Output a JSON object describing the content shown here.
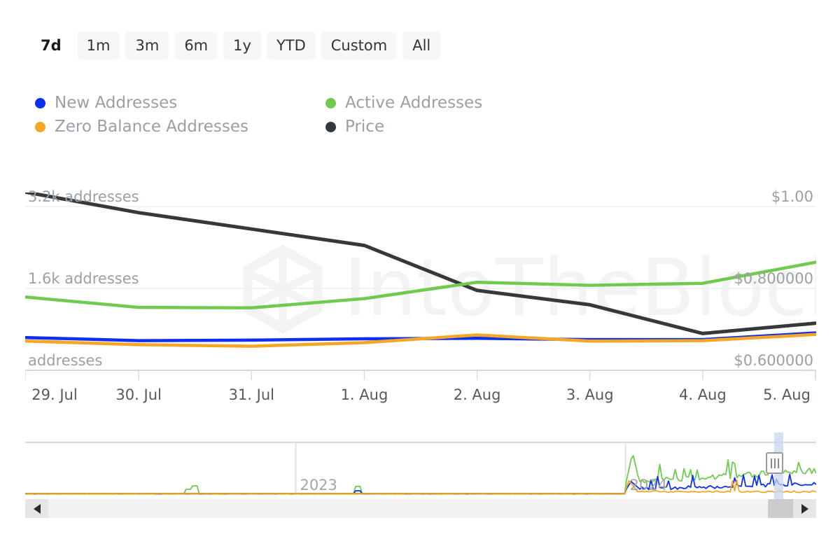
{
  "range_selector": {
    "buttons": [
      {
        "label": "7d",
        "active": true
      },
      {
        "label": "1m",
        "active": false
      },
      {
        "label": "3m",
        "active": false
      },
      {
        "label": "6m",
        "active": false
      },
      {
        "label": "1y",
        "active": false
      },
      {
        "label": "YTD",
        "active": false
      },
      {
        "label": "Custom",
        "active": false
      },
      {
        "label": "All",
        "active": false
      }
    ]
  },
  "legend": {
    "items": [
      {
        "label": "New Addresses",
        "color": "#0d2ff0"
      },
      {
        "label": "Active Addresses",
        "color": "#6ecb4d"
      },
      {
        "label": "Zero Balance Addresses",
        "color": "#f5a623"
      },
      {
        "label": "Price",
        "color": "#36393c"
      }
    ]
  },
  "watermark": {
    "text": "IntoTheBlock"
  },
  "navigator": {
    "year_labels": [
      {
        "text": "2023",
        "x_pct": 34.2
      },
      {
        "text": "2024",
        "x_pct": 75.9
      }
    ],
    "selection": {
      "start_pct": 94.7,
      "end_pct": 95.8
    },
    "scroll_left_icon": "triangle-left-icon",
    "scroll_right_icon": "triangle-right-icon",
    "handle_icon": "grip-vertical-icon"
  },
  "chart_data": {
    "type": "line",
    "title": "",
    "xlabel": "",
    "ylabel": "addresses",
    "grid": true,
    "legend_position": "top-left",
    "x": [
      "29. Jul",
      "30. Jul",
      "31. Jul",
      "1. Aug",
      "2. Aug",
      "3. Aug",
      "4. Aug",
      "5. Aug"
    ],
    "left_axis": {
      "label_suffix": "addresses",
      "ticks": [
        "addresses",
        "1.6k addresses",
        "3.2k addresses"
      ],
      "tick_values": [
        0,
        1600,
        3200
      ],
      "ylim": [
        0,
        4000
      ]
    },
    "right_axis": {
      "ticks": [
        "$0.600000",
        "$0.800000",
        "$1.00"
      ],
      "tick_values": [
        0.6,
        0.8,
        1.0
      ],
      "ylim": [
        0.52,
        1.06
      ]
    },
    "series": [
      {
        "name": "Active Addresses",
        "color": "#6ecb4d",
        "axis": "left",
        "values": [
          1430,
          1230,
          1220,
          1400,
          1720,
          1660,
          1700,
          2110
        ]
      },
      {
        "name": "New Addresses",
        "color": "#0d2ff0",
        "axis": "left",
        "values": [
          640,
          580,
          590,
          615,
          625,
          600,
          600,
          730
        ]
      },
      {
        "name": "Zero Balance Addresses",
        "color": "#f5a623",
        "axis": "left",
        "values": [
          570,
          500,
          470,
          540,
          690,
          570,
          580,
          700
        ]
      },
      {
        "name": "Price",
        "color": "#36393c",
        "axis": "right",
        "values": [
          1.035,
          0.985,
          0.945,
          0.905,
          0.795,
          0.76,
          0.69,
          0.715
        ]
      }
    ],
    "navigator_series": [
      {
        "name": "Active Addresses",
        "color": "#6ecb4d"
      },
      {
        "name": "New Addresses",
        "color": "#0d2ff0"
      },
      {
        "name": "Zero Balance Addresses",
        "color": "#f5a623"
      }
    ]
  }
}
